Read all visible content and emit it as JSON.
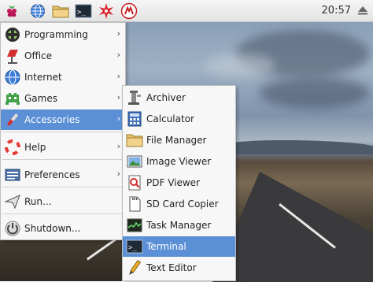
{
  "taskbar": {
    "clock": "20:57",
    "launchers": [
      "raspberry-menu-icon",
      "web-browser-icon",
      "file-manager-icon",
      "terminal-icon",
      "mathematica-icon",
      "wolfram-icon"
    ]
  },
  "main_menu": {
    "items": [
      {
        "label": "Programming",
        "icon": "programming-icon",
        "submenu": true
      },
      {
        "label": "Office",
        "icon": "office-icon",
        "submenu": true
      },
      {
        "label": "Internet",
        "icon": "internet-icon",
        "submenu": true
      },
      {
        "label": "Games",
        "icon": "games-icon",
        "submenu": true
      },
      {
        "label": "Accessories",
        "icon": "accessories-icon",
        "submenu": true,
        "selected": true
      },
      {
        "label": "Help",
        "icon": "help-icon",
        "submenu": true
      },
      {
        "label": "Preferences",
        "icon": "preferences-icon",
        "submenu": true
      },
      {
        "label": "Run...",
        "icon": "run-icon",
        "submenu": false
      },
      {
        "label": "Shutdown...",
        "icon": "shutdown-icon",
        "submenu": false
      }
    ]
  },
  "accessories_menu": {
    "items": [
      {
        "label": "Archiver",
        "icon": "archiver-icon"
      },
      {
        "label": "Calculator",
        "icon": "calculator-icon"
      },
      {
        "label": "File Manager",
        "icon": "folder-icon"
      },
      {
        "label": "Image Viewer",
        "icon": "image-viewer-icon"
      },
      {
        "label": "PDF Viewer",
        "icon": "pdf-viewer-icon"
      },
      {
        "label": "SD Card Copier",
        "icon": "sd-card-icon"
      },
      {
        "label": "Task Manager",
        "icon": "task-manager-icon"
      },
      {
        "label": "Terminal",
        "icon": "terminal-icon",
        "selected": true
      },
      {
        "label": "Text Editor",
        "icon": "text-editor-icon"
      }
    ]
  },
  "colors": {
    "selection": "#5b8fd6",
    "menu_bg": "#f7f7f7"
  }
}
